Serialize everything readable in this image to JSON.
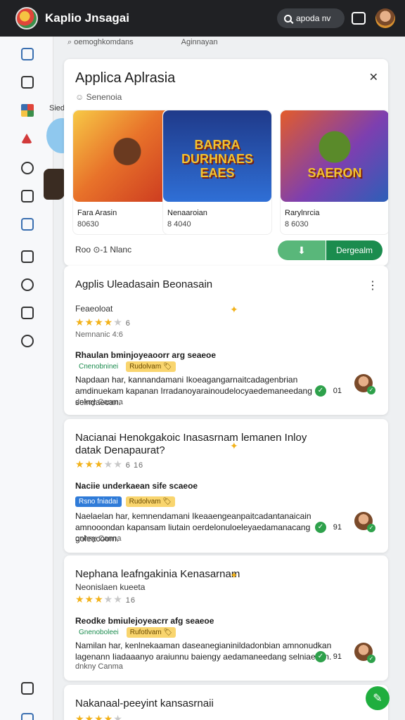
{
  "app": {
    "title": "Kaplio Jnsagai",
    "search_placeholder": "apoda nv"
  },
  "subheader": {
    "left": "oemoghkomdans",
    "right": "Aginnayan"
  },
  "sidebar": {
    "label": "Siedo"
  },
  "panel": {
    "title": "Applica Aplrasia",
    "subtitle": "Senenoia",
    "games": [
      {
        "name": "Fara Arasin",
        "price": "80630",
        "art_text": ""
      },
      {
        "name": "Nenaaroian",
        "price": "8 4040",
        "art_text": "BARRA DURHNAES EAES"
      },
      {
        "name": "Rarylnrcia",
        "price": "8 6030",
        "art_text": "SAERON"
      }
    ],
    "footer": "Roo ⊙-1 Nlanc",
    "like_button": "⬇",
    "download_button": "Dergealm",
    "close_icon": "close-icon"
  },
  "reviews": [
    {
      "title": "Agplis Uleadasain Beonasain",
      "subtitle": "Feaeoloat",
      "stars": 4,
      "rating_num": "6",
      "rating_line": "Nemnanic 4:6",
      "by": "Rhaulan bminjoyeaoorr arg seaeoe",
      "tags": [
        {
          "text": "Cnenobninei",
          "style": "g"
        },
        {
          "text": "Rudolvam 🏷",
          "style": "y"
        }
      ],
      "body": "Napdaan har, kannandamani Ikoeagangarnaitcadagenbrian amdinuekam kapanan Irradanoyarainoudelocyaedemaneedang selndaecan.",
      "meta": "dnkny Canma",
      "count": "01"
    },
    {
      "title": "Nacianai Henokgakoic Inasasrnam lemanen Inloy datak Denapaurat?",
      "subtitle": "",
      "stars": 3,
      "rating_num": "6 16",
      "rating_line": "",
      "by": "Naciie underkaean sife scaeoe",
      "tags": [
        {
          "text": "Rsno fniadai",
          "style": "b"
        },
        {
          "text": "Rudolvam 🏷",
          "style": "y"
        }
      ],
      "body": "Naelaelan har, kemnendamani Ikeaaengeanpaitcadantanaicain amnooondan kapansam liutain oerdelonuloeleyaedamanacang goleacoom.",
      "meta": "onhny Canna",
      "count": "91"
    },
    {
      "title": "Nephana leafngakinia Kenasarnam",
      "subtitle": "Neonislaen kueeta",
      "stars": 3,
      "rating_num": "16",
      "rating_line": "",
      "by": "Reodke bmiulejoyeacrr afg seaeoe",
      "tags": [
        {
          "text": "Gnenoboleei",
          "style": "g"
        },
        {
          "text": "Rufotlvam 🏷",
          "style": "y"
        }
      ],
      "body": "Namilan har, kenlnekaaman daseanegianinildadonbian amnonudkan lagenann Iiadaaanyo araiunnu baiengy aedamaneedang selniaecan.",
      "meta": "dnkny Canma",
      "count": "91"
    },
    {
      "title": "Nakanaal-peeyint kansasrnaii",
      "subtitle": "",
      "stars": 4,
      "rating_num": "",
      "rating_line": "",
      "by": "",
      "tags": [],
      "body": "",
      "meta": "",
      "count": ""
    }
  ]
}
